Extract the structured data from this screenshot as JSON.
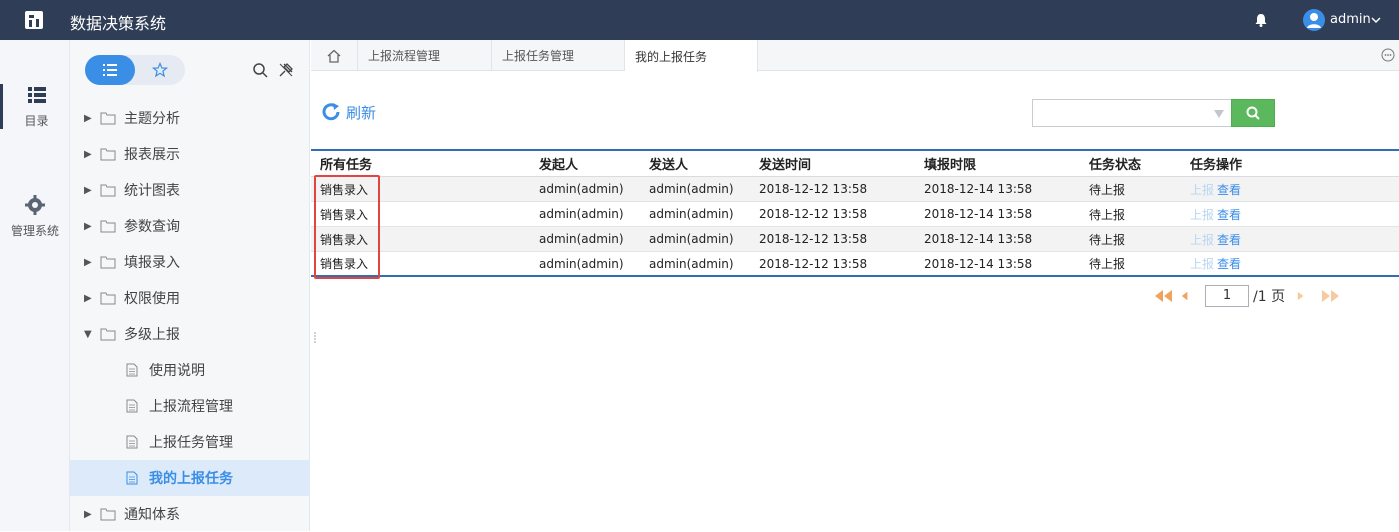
{
  "app": {
    "title": "数据决策系统",
    "user": "admin"
  },
  "rail": [
    {
      "label": "目录",
      "icon": "list-icon"
    },
    {
      "label": "管理系统",
      "icon": "gear-icon"
    }
  ],
  "tree": {
    "items": [
      {
        "label": "主题分析"
      },
      {
        "label": "报表展示"
      },
      {
        "label": "统计图表"
      },
      {
        "label": "参数查询"
      },
      {
        "label": "填报录入"
      },
      {
        "label": "权限使用"
      },
      {
        "label": "多级上报"
      },
      {
        "label": "使用说明"
      },
      {
        "label": "上报流程管理"
      },
      {
        "label": "上报任务管理"
      },
      {
        "label": "我的上报任务"
      },
      {
        "label": "通知体系"
      }
    ]
  },
  "tabs": [
    {
      "label": "上报流程管理"
    },
    {
      "label": "上报任务管理"
    },
    {
      "label": "我的上报任务"
    }
  ],
  "toolbar": {
    "refresh_label": "刷新",
    "search_value": ""
  },
  "table": {
    "columns": [
      "所有任务",
      "发起人",
      "发送人",
      "发送时间",
      "填报时限",
      "任务状态",
      "任务操作"
    ],
    "rows": [
      {
        "task": "销售录入",
        "initiator": "admin(admin)",
        "sender": "admin(admin)",
        "sent": "2018-12-12 13:58",
        "deadline": "2018-12-14 13:58",
        "status": "待上报",
        "op_report": "上报",
        "op_view": "查看"
      },
      {
        "task": "销售录入",
        "initiator": "admin(admin)",
        "sender": "admin(admin)",
        "sent": "2018-12-12 13:58",
        "deadline": "2018-12-14 13:58",
        "status": "待上报",
        "op_report": "上报",
        "op_view": "查看"
      },
      {
        "task": "销售录入",
        "initiator": "admin(admin)",
        "sender": "admin(admin)",
        "sent": "2018-12-12 13:58",
        "deadline": "2018-12-14 13:58",
        "status": "待上报",
        "op_report": "上报",
        "op_view": "查看"
      },
      {
        "task": "销售录入",
        "initiator": "admin(admin)",
        "sender": "admin(admin)",
        "sent": "2018-12-12 13:58",
        "deadline": "2018-12-14 13:58",
        "status": "待上报",
        "op_report": "上报",
        "op_view": "查看"
      }
    ]
  },
  "pager": {
    "page": "1",
    "total": "/1 页"
  },
  "colors": {
    "header_bg": "#2f3d56",
    "accent": "#3a8ee6",
    "search_button": "#5cb85c",
    "highlight": "#e0463e",
    "pager_arrow": "#f0a35e"
  }
}
